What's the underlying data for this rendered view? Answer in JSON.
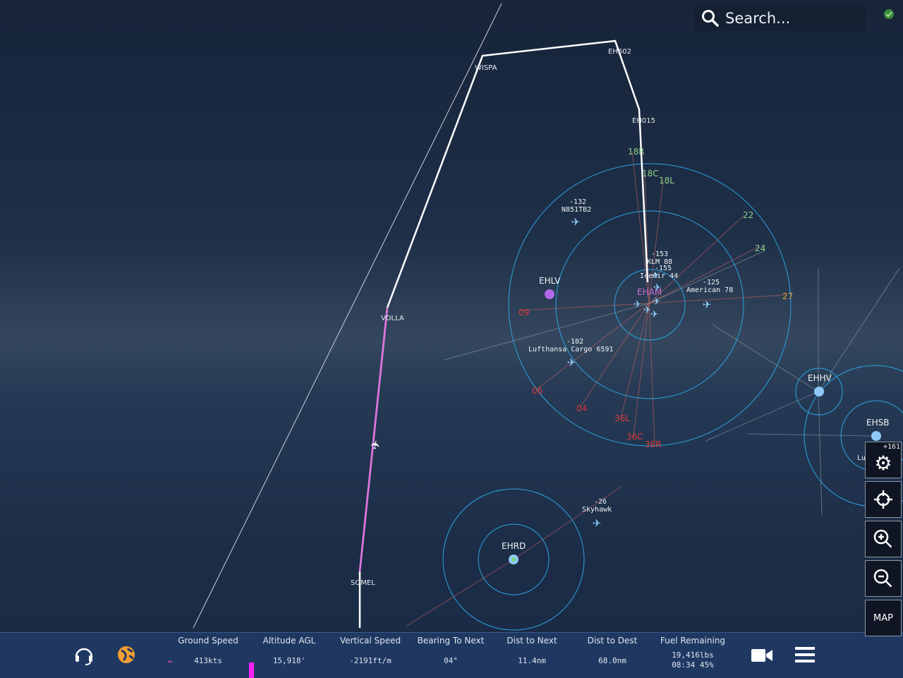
{
  "search": {
    "placeholder": "Search..."
  },
  "waypoints": [
    "WISPA",
    "EH602",
    "EH015",
    "VOLLA",
    "SOMEL"
  ],
  "airports": {
    "ehlv": "EHLV",
    "eham": "EHAM",
    "ehhv": "EHHV",
    "ehsb": "EHSB",
    "ehrd": "EHRD"
  },
  "runways": {
    "r18r": "18R",
    "r18c": "18C",
    "r18l": "18L",
    "r22": "22",
    "r24": "24",
    "r27": "27",
    "r09": "09",
    "r06": "06",
    "r04": "04",
    "r36l": "36L",
    "r36c": "36C",
    "r36r": "36R"
  },
  "traffic": [
    {
      "alt": "-132",
      "callsign": "N851TB2"
    },
    {
      "alt": "-153",
      "callsign": "KLM 88"
    },
    {
      "alt": "-155",
      "callsign": "IceAir 44"
    },
    {
      "alt": "-125",
      "callsign": "American 78"
    },
    {
      "alt": "-102",
      "callsign": "Lufthansa Cargo 6591"
    },
    {
      "alt": "-26",
      "callsign": "Skyhawk"
    },
    {
      "alt": "+161",
      "callsign": "Lufthansa"
    }
  ],
  "tools": {
    "map_label": "MAP"
  },
  "stats": [
    {
      "label": "Ground Speed",
      "value": "413kts"
    },
    {
      "label": "Altitude AGL",
      "value": "15,918'"
    },
    {
      "label": "Vertical Speed",
      "value": "-2191ft/m"
    },
    {
      "label": "Bearing To Next",
      "value": "04°"
    },
    {
      "label": "Dist to Next",
      "value": "11.4nm"
    },
    {
      "label": "Dist to Dest",
      "value": "68.0nm"
    },
    {
      "label": "Fuel Remaining",
      "value": "19,416lbs",
      "value2": "08:34 45%"
    }
  ],
  "colors": {
    "route": "#ffffff",
    "active_leg": "#e070e0",
    "rings": "#2ba4e0",
    "traffic": "#8ccaf5",
    "bar": "#1f3862"
  }
}
